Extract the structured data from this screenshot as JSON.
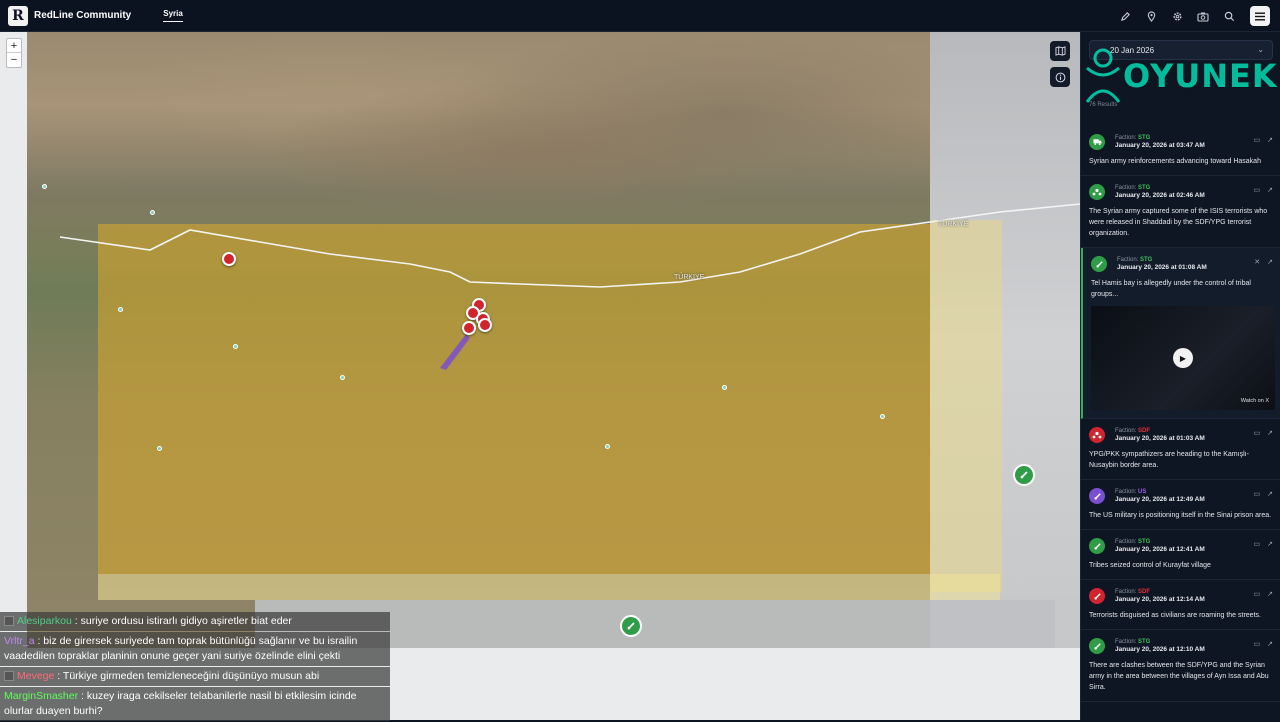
{
  "topbar": {
    "logo_letter": "R",
    "app_title": "RedLine Community",
    "tab_label": "Syria",
    "icons": [
      "pen-icon",
      "pin-icon",
      "gear-icon",
      "camera-icon",
      "search-icon",
      "menu-icon"
    ]
  },
  "map": {
    "zoom_in": "+",
    "zoom_out": "−",
    "region_label": "TÜRKİYE",
    "region_label_2": "TÜRKİYE",
    "colors": {
      "controlled_area": "#dcaa28",
      "marker_red": "#d0242f",
      "marker_green": "#2f9d47",
      "route": "#7a4fd0"
    }
  },
  "chat": [
    {
      "user": "Alesiparkou",
      "message": ": suriye ordusu istirarlı gidiyo aşiretler biat eder"
    },
    {
      "user": "Vrltr_a",
      "message": ": biz de girersek suriyede tam toprak bütünlüğü sağlanır ve bu israilin vaadedilen topraklar planinin onune geçer yani suriye özelinde elini çekti"
    },
    {
      "user": "Mevege",
      "message": ": Türkiye girmeden temizleneceğini düşünüyo musun abi"
    },
    {
      "user": "MarginSmasher",
      "message": ": kuzey iraga cekilseler telabanilerle nasil bi etkilesim icinde olurlar duayen burhi?"
    }
  ],
  "sidebar": {
    "date_value": "20 Jan 2026",
    "watermark": "OYUNEKS",
    "results_count": "76 Results",
    "feed": [
      {
        "faction_label": "Faction:",
        "faction": "STG",
        "faction_color": "#3fbf5a",
        "time": "January 20, 2026 at 03:47 AM",
        "text": "Syrian army reinforcements advancing toward Hasakah",
        "badge_color": "#2f9d47",
        "icon": "truck-icon"
      },
      {
        "faction_label": "Faction:",
        "faction": "STG",
        "faction_color": "#3fbf5a",
        "time": "January 20, 2026 at 02:46 AM",
        "text": "The Syrian army captured some of the ISIS terrorists who were released in Shaddadi by the SDF/YPG terrorist organization.",
        "badge_color": "#2f9d47",
        "icon": "group-icon"
      },
      {
        "faction_label": "Faction:",
        "faction": "STG",
        "faction_color": "#3fbf5a",
        "time": "January 20, 2026 at 01:08 AM",
        "text": "Tel Hamis bay is allegedly under the control of tribal groups...",
        "badge_color": "#2f9d47",
        "icon": "rifle-icon",
        "video_label": "Watch on X"
      },
      {
        "faction_label": "Faction:",
        "faction": "SDF",
        "faction_color": "#e0303a",
        "time": "January 20, 2026 at 01:03 AM",
        "text": "YPG/PKK sympathizers are heading to the Kamışlı-Nusaybin border area.",
        "badge_color": "#d0242f",
        "icon": "group-icon"
      },
      {
        "faction_label": "Faction:",
        "faction": "US",
        "faction_color": "#9b5de5",
        "time": "January 20, 2026 at 12:49 AM",
        "text": "The US military is positioning itself in the Sinai prison area.",
        "badge_color": "#7a4fd0",
        "icon": "rifle-icon"
      },
      {
        "faction_label": "Faction:",
        "faction": "STG",
        "faction_color": "#3fbf5a",
        "time": "January 20, 2026 at 12:41 AM",
        "text": "Tribes seized control of Kurayfat village",
        "badge_color": "#2f9d47",
        "icon": "rifle-icon"
      },
      {
        "faction_label": "Faction:",
        "faction": "SDF",
        "faction_color": "#e0303a",
        "time": "January 20, 2026 at 12:14 AM",
        "text": "Terrorists disguised as civilians are roaming the streets.",
        "badge_color": "#d0242f",
        "icon": "rifle-icon"
      },
      {
        "faction_label": "Faction:",
        "faction": "STG",
        "faction_color": "#3fbf5a",
        "time": "January 20, 2026 at 12:10 AM",
        "text": "There are clashes between the SDF/YPG and the Syrian army in the area between the villages of Ayn Issa and Abu Sirra.",
        "badge_color": "#2f9d47",
        "icon": "rifle-icon"
      }
    ]
  }
}
